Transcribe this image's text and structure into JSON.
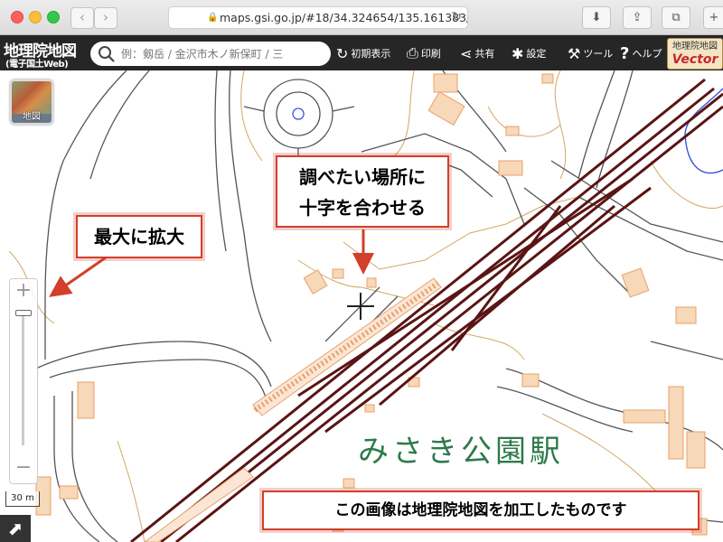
{
  "browser": {
    "url": "maps.gsi.go.jp/#18/34.324654/135.161383/",
    "back_icon": "‹",
    "forward_icon": "›",
    "reload_icon": "↻",
    "download_icon": "⬇",
    "share_icon": "⇪",
    "tabs_icon": "⧉",
    "newtab_icon": "+"
  },
  "header": {
    "logo_main": "地理院地図",
    "logo_sub": "(電子国土Web)",
    "search_placeholder": "例：剱岳 / 金沢市木ノ新保町 / 三",
    "buttons": [
      {
        "icon": "↻",
        "label": "初期表示"
      },
      {
        "icon": "⎙",
        "label": "印刷"
      },
      {
        "icon": "⋖",
        "label": "共有"
      },
      {
        "icon": "✱",
        "label": "設定"
      },
      {
        "icon": "⚒",
        "label": "ツール"
      },
      {
        "icon": "?",
        "label": "ヘルプ"
      }
    ],
    "vector_badge_top": "地理院地図",
    "vector_badge_bottom": "Vector"
  },
  "map": {
    "layer_button_label": "地図",
    "zoom_in": "+",
    "zoom_out": "−",
    "zoom_level_fraction": 1.0,
    "scale_label": "30 m",
    "station_label": "みさき公園駅",
    "expand_icon": "⬈"
  },
  "callouts": {
    "zoom": "最大に拡大",
    "place_line1": "調べたい場所に",
    "place_line2": "十字を合わせる",
    "credit": "この画像は地理院地図を加工したものです"
  },
  "colors": {
    "header_bg": "#262626",
    "callout_border": "#d23f2a",
    "building_fill": "#f7d8b8",
    "building_stroke": "#e8a06a",
    "railway": "#5a1414",
    "road": "#555555",
    "contour": "#d3a766",
    "water": "#2c4bd8",
    "station_text": "#2e7a4a"
  }
}
